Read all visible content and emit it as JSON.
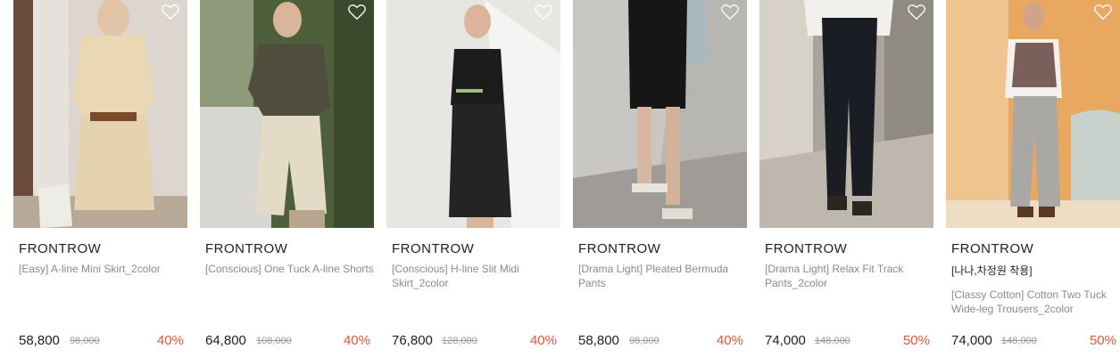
{
  "colors": {
    "accent": "#e2563b",
    "brand": "#222222",
    "muted": "#8a8a8a"
  },
  "products": [
    {
      "brand": "FRONTROW",
      "name": "[Easy] A-line Mini Skirt_2color",
      "price": "58,800",
      "original_price": "98,000",
      "discount": "40%",
      "icon": "heart-icon"
    },
    {
      "brand": "FRONTROW",
      "name": "[Conscious] One Tuck A-line Shorts",
      "price": "64,800",
      "original_price": "108,000",
      "discount": "40%",
      "icon": "heart-icon"
    },
    {
      "brand": "FRONTROW",
      "name": "[Conscious] H-line Slit Midi Skirt_2color",
      "price": "76,800",
      "original_price": "128,000",
      "discount": "40%",
      "icon": "heart-icon"
    },
    {
      "brand": "FRONTROW",
      "name": "[Drama Light] Pleated Bermuda Pants",
      "price": "58,800",
      "original_price": "98,000",
      "discount": "40%",
      "icon": "heart-icon"
    },
    {
      "brand": "FRONTROW",
      "name": "[Drama Light] Relax Fit Track Pants_2color",
      "price": "74,000",
      "original_price": "148,000",
      "discount": "50%",
      "icon": "heart-icon"
    },
    {
      "brand": "FRONTROW",
      "tag": "[나나,차정원 착용]",
      "name": "[Classy Cotton] Cotton Two Tuck Wide-leg Trousers_2color",
      "price": "74,000",
      "original_price": "148,000",
      "discount": "50%",
      "icon": "heart-icon"
    }
  ]
}
